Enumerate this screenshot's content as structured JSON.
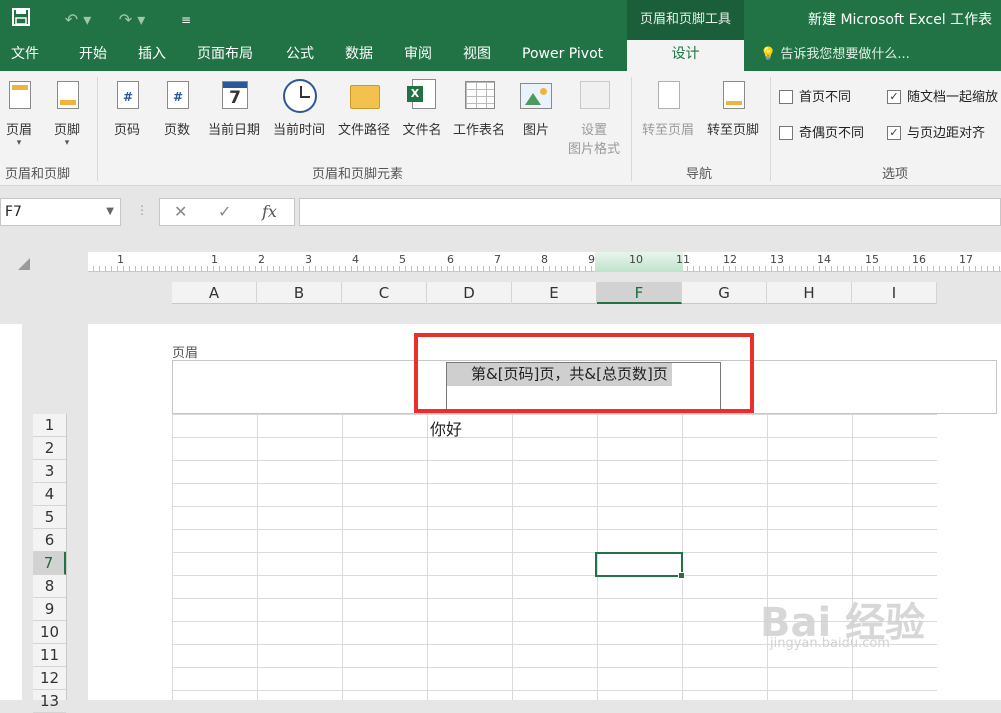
{
  "titlebar": {
    "quick_access": [
      "save-icon",
      "undo-icon",
      "redo-icon",
      "customize-icon"
    ],
    "context_title": "页眉和页脚工具",
    "doc_title": "新建 Microsoft Excel 工作表"
  },
  "tabs": [
    "文件",
    "开始",
    "插入",
    "页面布局",
    "公式",
    "数据",
    "审阅",
    "视图",
    "Power Pivot"
  ],
  "active_tab": "设计",
  "tell_me": "告诉我您想要做什么...",
  "ribbon": {
    "hf_group": {
      "label": "页眉和页脚",
      "buttons": [
        "页眉",
        "页脚"
      ]
    },
    "elements_group": {
      "label": "页眉和页脚元素",
      "buttons": [
        "页码",
        "页数",
        "当前日期",
        "当前时间",
        "文件路径",
        "文件名",
        "工作表名",
        "图片"
      ],
      "format_button": [
        "设置",
        "图片格式"
      ]
    },
    "nav_group": {
      "label": "导航",
      "buttons": [
        "转至页眉",
        "转至页脚"
      ]
    },
    "options_group": {
      "label": "选项",
      "checkboxes": [
        {
          "label": "首页不同",
          "checked": false
        },
        {
          "label": "随文档一起缩放",
          "checked": true
        },
        {
          "label": "奇偶页不同",
          "checked": false
        },
        {
          "label": "与页边距对齐",
          "checked": true
        }
      ]
    }
  },
  "formula_bar": {
    "name_box": "F7",
    "fx": "fx",
    "value": ""
  },
  "ruler_numbers": [
    "1",
    "1",
    "2",
    "3",
    "4",
    "5",
    "6",
    "7",
    "8",
    "9",
    "10",
    "11",
    "12",
    "13",
    "14",
    "15",
    "16",
    "17"
  ],
  "columns": [
    "A",
    "B",
    "C",
    "D",
    "E",
    "F",
    "G",
    "H",
    "I"
  ],
  "selected_column": "F",
  "rows": [
    "1",
    "2",
    "3",
    "4",
    "5",
    "6",
    "7",
    "8",
    "9",
    "10",
    "11",
    "12",
    "13"
  ],
  "selected_row": "7",
  "page": {
    "header_label": "页眉",
    "header_center_text": "第&[页码]页，共&[总页数]页",
    "cell_d1": "你好"
  },
  "watermark": {
    "main": "Bai 经验",
    "sub": "jingyan.baidu.com"
  },
  "colors": {
    "accent": "#217346",
    "highlight": "#e8302e"
  }
}
